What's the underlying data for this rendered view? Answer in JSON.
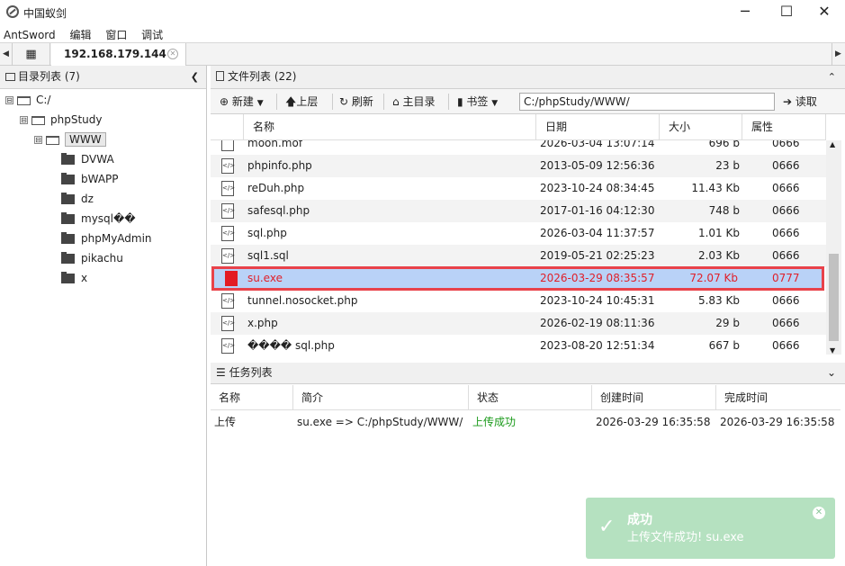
{
  "window": {
    "title": "中国蚁剑",
    "minimize": "─",
    "maximize": "☐",
    "close": "✕"
  },
  "menu": [
    "AntSword",
    "编辑",
    "窗口",
    "调试"
  ],
  "tabs": {
    "left_arrow": "◀",
    "right_arrow": "▶",
    "grid_icon": "▦",
    "host": "192.168.179.144",
    "close": "✕"
  },
  "dir_panel": {
    "title": "目录列表 (7)",
    "collapse": "❮"
  },
  "tree": [
    {
      "label": "C:/",
      "expander": "⊟",
      "level": 0,
      "type": "open"
    },
    {
      "label": "phpStudy",
      "expander": "⊟",
      "level": 1,
      "type": "open"
    },
    {
      "label": "WWW",
      "expander": "⊟",
      "level": 2,
      "type": "open",
      "selected": true
    },
    {
      "label": "DVWA",
      "level": 3,
      "type": "solid"
    },
    {
      "label": "bWAPP",
      "level": 3,
      "type": "solid"
    },
    {
      "label": "dz",
      "level": 3,
      "type": "solid"
    },
    {
      "label": "mysql\u0001��",
      "level": 3,
      "type": "solid"
    },
    {
      "label": "phpMyAdmin",
      "level": 3,
      "type": "solid"
    },
    {
      "label": "pikachu",
      "level": 3,
      "type": "solid"
    },
    {
      "label": "x",
      "level": 3,
      "type": "solid"
    }
  ],
  "file_panel": {
    "title": "文件列表 (22)",
    "collapse": "⌃"
  },
  "toolbar": {
    "new": "新建",
    "up": "上层",
    "refresh": "刷新",
    "home": "主目录",
    "bookmark": "书签",
    "path": "C:/phpStudy/WWW/",
    "read": "读取"
  },
  "columns": {
    "name": "名称",
    "date": "日期",
    "size": "大小",
    "attr": "属性"
  },
  "files": [
    {
      "name": "moon.mof",
      "date": "2026-03-04 13:07:14",
      "size": "696 b",
      "attr": "0666",
      "icon": "doc"
    },
    {
      "name": "phpinfo.php",
      "date": "2013-05-09 12:56:36",
      "size": "23 b",
      "attr": "0666",
      "icon": "code"
    },
    {
      "name": "reDuh.php",
      "date": "2023-10-24 08:34:45",
      "size": "11.43 Kb",
      "attr": "0666",
      "icon": "code"
    },
    {
      "name": "safesql.php",
      "date": "2017-01-16 04:12:30",
      "size": "748 b",
      "attr": "0666",
      "icon": "code"
    },
    {
      "name": "sql.php",
      "date": "2026-03-04 11:37:57",
      "size": "1.01 Kb",
      "attr": "0666",
      "icon": "code"
    },
    {
      "name": "sql1.sql",
      "date": "2019-05-21 02:25:23",
      "size": "2.03 Kb",
      "attr": "0666",
      "icon": "code"
    },
    {
      "name": "su.exe",
      "date": "2026-03-29 08:35:57",
      "size": "72.07 Kb",
      "attr": "0777",
      "icon": "exe",
      "highlight": true
    },
    {
      "name": "tunnel.nosocket.php",
      "date": "2023-10-24 10:45:31",
      "size": "5.83 Kb",
      "attr": "0666",
      "icon": "code"
    },
    {
      "name": "x.php",
      "date": "2026-02-19 08:11:36",
      "size": "29 b",
      "attr": "0666",
      "icon": "code"
    },
    {
      "name": "���� sql.php",
      "date": "2023-08-20 12:51:34",
      "size": "667 b",
      "attr": "0666",
      "icon": "code"
    }
  ],
  "tasks": {
    "title": "任务列表",
    "collapse": "⌄",
    "columns": {
      "name": "名称",
      "desc": "简介",
      "status": "状态",
      "created": "创建时间",
      "finished": "完成时间"
    },
    "row": {
      "name": "上传",
      "desc": "su.exe => C:/phpStudy/WWW/",
      "status": "上传成功",
      "created": "2026-03-29 16:35:58",
      "finished": "2026-03-29 16:35:58"
    }
  },
  "toast": {
    "title": "成功",
    "message": "上传文件成功!   su.exe",
    "check": "✓",
    "close": "✕"
  },
  "colors": {
    "highlight_border": "#e8424a",
    "highlight_bg": "#b9d2f7",
    "success_text": "#1a9a1a",
    "toast_bg": "#78c88c"
  }
}
